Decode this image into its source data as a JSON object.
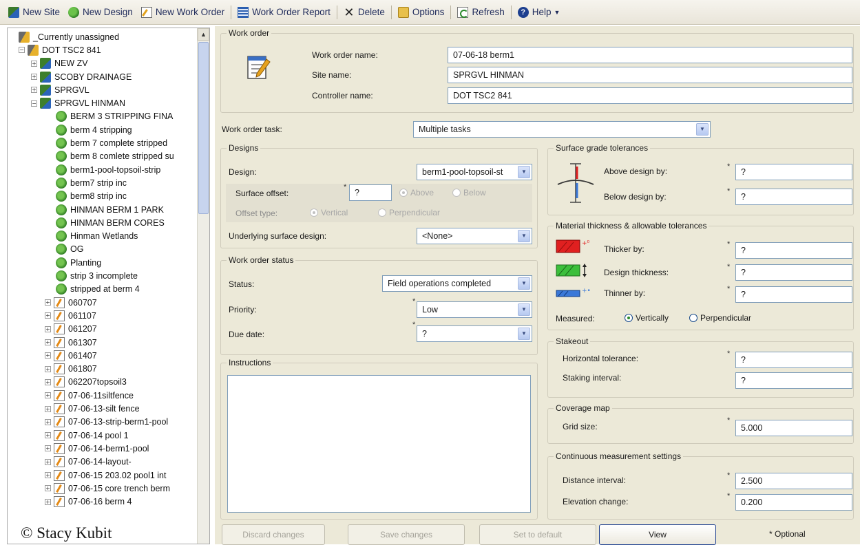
{
  "toolbar": {
    "items": [
      {
        "label": "New Site",
        "icon": "new-site-icon"
      },
      {
        "label": "New Design",
        "icon": "new-design-icon"
      },
      {
        "label": "New Work Order",
        "icon": "new-work-order-icon"
      },
      {
        "label": "Work Order Report",
        "icon": "report-icon"
      },
      {
        "label": "Delete",
        "icon": "delete-icon"
      },
      {
        "label": "Options",
        "icon": "options-icon"
      },
      {
        "label": "Refresh",
        "icon": "refresh-icon"
      },
      {
        "label": "Help",
        "icon": "help-icon"
      }
    ]
  },
  "tree": {
    "rows": [
      {
        "label": "_Currently unassigned",
        "icon": "controller",
        "indent": 0,
        "expander": ""
      },
      {
        "label": "DOT TSC2 841",
        "icon": "controller",
        "indent": 0,
        "expander": "−"
      },
      {
        "label": "NEW ZV",
        "icon": "site",
        "indent": 1,
        "expander": "+"
      },
      {
        "label": "SCOBY DRAINAGE",
        "icon": "site",
        "indent": 1,
        "expander": "+"
      },
      {
        "label": "SPRGVL",
        "icon": "site",
        "indent": 1,
        "expander": "+"
      },
      {
        "label": "SPRGVL HINMAN",
        "icon": "site",
        "indent": 1,
        "expander": "−"
      },
      {
        "label": "BERM 3 STRIPPING FINA",
        "icon": "design",
        "indent": 2,
        "expander": ""
      },
      {
        "label": "berm 4 stripping",
        "icon": "design",
        "indent": 2,
        "expander": ""
      },
      {
        "label": "berm 7 complete stripped",
        "icon": "design",
        "indent": 2,
        "expander": ""
      },
      {
        "label": "berm 8 comlete stripped su",
        "icon": "design",
        "indent": 2,
        "expander": ""
      },
      {
        "label": "berm1-pool-topsoil-strip",
        "icon": "design",
        "indent": 2,
        "expander": ""
      },
      {
        "label": "berm7 strip inc",
        "icon": "design",
        "indent": 2,
        "expander": ""
      },
      {
        "label": "berm8 strip inc",
        "icon": "design",
        "indent": 2,
        "expander": ""
      },
      {
        "label": "HINMAN BERM 1 PARK",
        "icon": "design",
        "indent": 2,
        "expander": ""
      },
      {
        "label": "HINMAN BERM CORES",
        "icon": "design",
        "indent": 2,
        "expander": ""
      },
      {
        "label": "Hinman Wetlands",
        "icon": "design",
        "indent": 2,
        "expander": ""
      },
      {
        "label": "OG",
        "icon": "design",
        "indent": 2,
        "expander": ""
      },
      {
        "label": "Planting",
        "icon": "design",
        "indent": 2,
        "expander": ""
      },
      {
        "label": "strip 3 incomplete",
        "icon": "design",
        "indent": 2,
        "expander": ""
      },
      {
        "label": "stripped at berm 4",
        "icon": "design",
        "indent": 2,
        "expander": ""
      },
      {
        "label": "060707",
        "icon": "workorder",
        "indent": 2,
        "expander": "+"
      },
      {
        "label": "061107",
        "icon": "workorder",
        "indent": 2,
        "expander": "+"
      },
      {
        "label": "061207",
        "icon": "workorder",
        "indent": 2,
        "expander": "+"
      },
      {
        "label": "061307",
        "icon": "workorder",
        "indent": 2,
        "expander": "+"
      },
      {
        "label": "061407",
        "icon": "workorder",
        "indent": 2,
        "expander": "+"
      },
      {
        "label": "061807",
        "icon": "workorder",
        "indent": 2,
        "expander": "+"
      },
      {
        "label": "062207topsoil3",
        "icon": "workorder",
        "indent": 2,
        "expander": "+"
      },
      {
        "label": "07-06-11siltfence",
        "icon": "workorder",
        "indent": 2,
        "expander": "+"
      },
      {
        "label": "07-06-13-silt fence",
        "icon": "workorder",
        "indent": 2,
        "expander": "+"
      },
      {
        "label": "07-06-13-strip-berm1-pool",
        "icon": "workorder",
        "indent": 2,
        "expander": "+"
      },
      {
        "label": "07-06-14 pool 1",
        "icon": "workorder",
        "indent": 2,
        "expander": "+"
      },
      {
        "label": "07-06-14-berm1-pool",
        "icon": "workorder",
        "indent": 2,
        "expander": "+"
      },
      {
        "label": "07-06-14-layout-",
        "icon": "workorder",
        "indent": 2,
        "expander": "+"
      },
      {
        "label": "07-06-15 203.02 pool1 int",
        "icon": "workorder",
        "indent": 2,
        "expander": "+"
      },
      {
        "label": "07-06-15 core trench berm",
        "icon": "workorder",
        "indent": 2,
        "expander": "+"
      },
      {
        "label": "07-06-16 berm 4",
        "icon": "workorder",
        "indent": 2,
        "expander": "+"
      }
    ]
  },
  "watermark": "© Stacy Kubit",
  "work_order": {
    "legend": "Work order",
    "name_label": "Work order name:",
    "name_value": "07-06-18 berm1",
    "site_label": "Site name:",
    "site_value": "SPRGVL HINMAN",
    "controller_label": "Controller name:",
    "controller_value": "DOT TSC2 841"
  },
  "task": {
    "label": "Work order task:",
    "value": "Multiple tasks"
  },
  "designs": {
    "legend": "Designs",
    "design_label": "Design:",
    "design_value": "berm1-pool-topsoil-st",
    "offset_label": "Surface offset:",
    "offset_value": "?",
    "above_label": "Above",
    "below_label": "Below",
    "offset_type_label": "Offset type:",
    "vertical_label": "Vertical",
    "perpendicular_label": "Perpendicular",
    "underlying_label": "Underlying surface design:",
    "underlying_value": "<None>"
  },
  "status": {
    "legend": "Work order status",
    "status_label": "Status:",
    "status_value": "Field operations completed",
    "priority_label": "Priority:",
    "priority_value": "Low",
    "due_label": "Due date:",
    "due_value": "?"
  },
  "instructions": {
    "legend": "Instructions",
    "value": ""
  },
  "grade": {
    "legend": "Surface grade tolerances",
    "above_label": "Above design by:",
    "above_value": "?",
    "below_label": "Below design by:",
    "below_value": "?"
  },
  "material": {
    "legend": "Material thickness & allowable tolerances",
    "thicker_label": "Thicker by:",
    "thicker_value": "?",
    "design_label": "Design thickness:",
    "design_value": "?",
    "thinner_label": "Thinner by:",
    "thinner_value": "?",
    "measured_label": "Measured:",
    "vertically_label": "Vertically",
    "perpendicular_label": "Perpendicular"
  },
  "stakeout": {
    "legend": "Stakeout",
    "horizontal_label": "Horizontal tolerance:",
    "horizontal_value": "?",
    "interval_label": "Staking interval:",
    "interval_value": "?"
  },
  "coverage": {
    "legend": "Coverage map",
    "grid_label": "Grid size:",
    "grid_value": "5.000"
  },
  "continuous": {
    "legend": "Continuous measurement settings",
    "distance_label": "Distance interval:",
    "distance_value": "2.500",
    "elevation_label": "Elevation change:",
    "elevation_value": "0.200"
  },
  "buttons": {
    "discard": "Discard changes",
    "save": "Save changes",
    "default": "Set to default",
    "view": "View"
  },
  "optional_note": "* Optional",
  "required_mark": "*",
  "colors": {
    "panel_bg": "#ece9d8",
    "field_border": "#7f9db9",
    "thicker": "#e02020",
    "design": "#3cbf3c",
    "thinner": "#3a78d8"
  }
}
